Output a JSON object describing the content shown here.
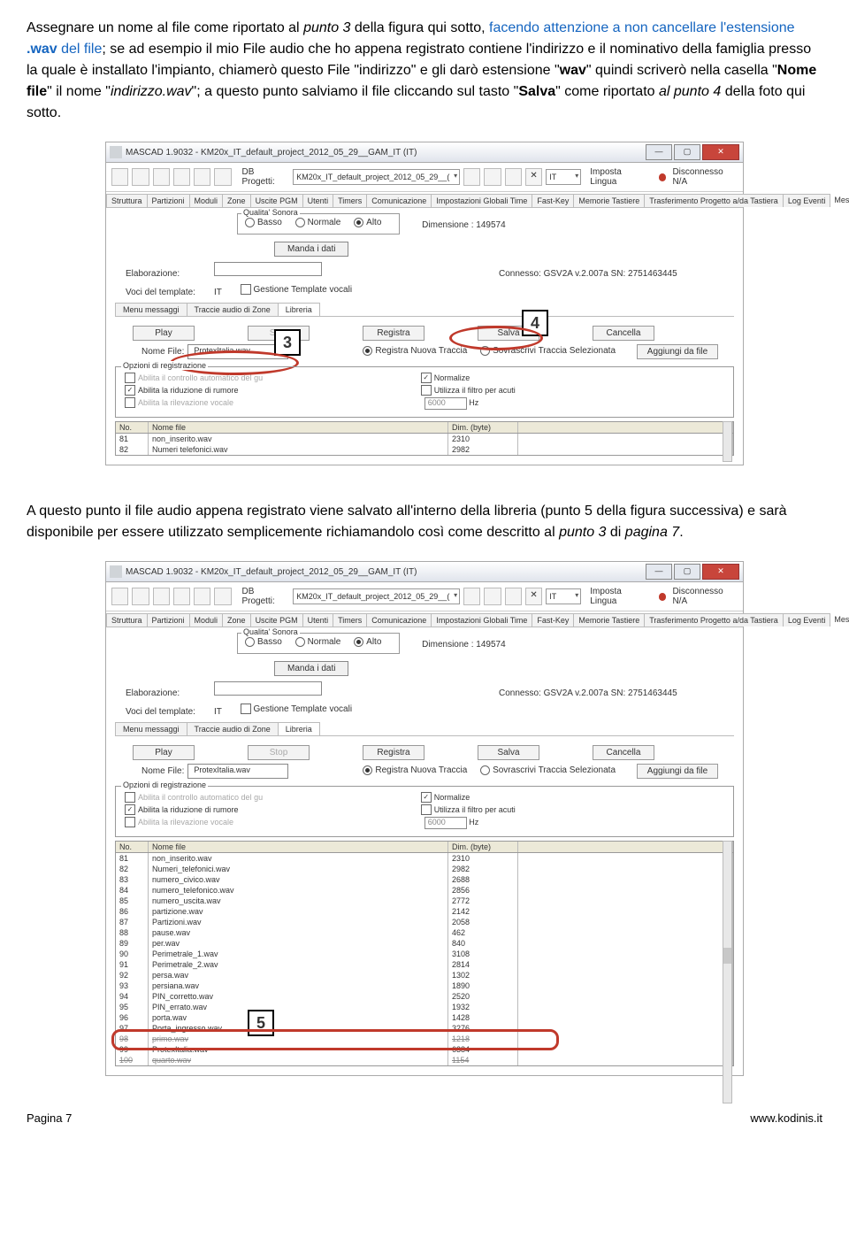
{
  "para1": {
    "t1": "Assegnare un nome al file come riportato al ",
    "p3": "punto 3",
    "t2": " della figura qui sotto, ",
    "blue1": "facendo attenzione a non cancellare l'estensione ",
    "ext": ".wav",
    "blue2": " del file",
    "t3": "; se ad esempio il mio File audio che ho appena registrato contiene l'indirizzo e il nominativo della famiglia presso la quale è installato l'impianto, chiamerò questo File \"indirizzo\" e gli darò estensione \"",
    "wav": "wav",
    "t4": "\" quindi scriverò nella casella \"",
    "nomefile": "Nome file",
    "t5": "\" il nome \"",
    "fname": "indirizzo.wav",
    "t6": "\"; a questo punto salviamo il file cliccando sul tasto \"",
    "salva": "Salva",
    "t7": "\" come riportato ",
    "p4": "al punto 4",
    "t8": " della foto qui sotto."
  },
  "para2": {
    "t1": "A questo punto il file audio appena registrato viene salvato all'interno della libreria (punto 5 della figura successiva) e sarà disponibile per essere utilizzato semplicemente richiamandolo così come descritto al ",
    "p3": "punto 3",
    "t2": " di ",
    "pg": "pagina 7",
    "t3": "."
  },
  "app": {
    "title": "MASCAD 1.9032  -  KM20x_IT_default_project_2012_05_29__GAM_IT (IT)",
    "dbLabel": "DB Progetti:",
    "dbValue": "KM20x_IT_default_project_2012_05_29__(",
    "lang": "IT",
    "imposta": "Imposta Lingua",
    "disc": "Disconnesso  N/A",
    "tabs": [
      "Struttura",
      "Partizioni",
      "Moduli",
      "Zone",
      "Uscite PGM",
      "Utenti",
      "Timers",
      "Comunicazione",
      "Impostazioni Globali Time",
      "Fast-Key",
      "Memorie Tastiere",
      "Trasferimento Progetto a/da Tastiera",
      "Log Eventi"
    ],
    "msgvoce": "Messaggio voce n.s",
    "quality": {
      "legend": "Qualita' Sonora",
      "basso": "Basso",
      "normale": "Normale",
      "alto": "Alto",
      "dim": "Dimensione : 149574"
    },
    "manda": "Manda i dati",
    "elab": "Elaborazione:",
    "connesso": "Connesso: GSV2A v.2.007a SN: 2751463445",
    "voci": "Voci del template:",
    "it": "IT",
    "gestione": "Gestione Template vocali",
    "subtabs": [
      "Menu messaggi",
      "Traccie audio di Zone",
      "Libreria"
    ],
    "play": "Play",
    "stop": "Stop",
    "registra": "Registra",
    "salva": "Salva",
    "cancella": "Cancella",
    "nomefileLbl": "Nome File:",
    "nomefileVal": "ProtexItalia.wav",
    "regNuova": "Registra Nuova Traccia",
    "sovras": "Sovrascrivi Traccia Selezionata",
    "aggiungi": "Aggiungi da file",
    "optLegend": "Opzioni di registrazione",
    "opt1": "Abilita il controllo automatico del gu",
    "opt2": "Abilita la riduzione di rumore",
    "opt3": "Abilita la rilevazione vocale",
    "norm": "Normalize",
    "filtro": "Utilizza il filtro per acuti",
    "hz": "6000",
    "hzu": "Hz",
    "cols": {
      "no": "No.",
      "nome": "Nome file",
      "dim": "Dim. (byte)"
    }
  },
  "shot1_rows": [
    {
      "n": "81",
      "f": "non_inserito.wav",
      "d": "2310"
    },
    {
      "n": "82",
      "f": "Numeri  telefonici.wav",
      "d": "2982"
    }
  ],
  "shot2_rows": [
    {
      "n": "81",
      "f": "non_inserito.wav",
      "d": "2310"
    },
    {
      "n": "82",
      "f": "Numeri_telefonici.wav",
      "d": "2982"
    },
    {
      "n": "83",
      "f": "numero_civico.wav",
      "d": "2688"
    },
    {
      "n": "84",
      "f": "numero_telefonico.wav",
      "d": "2856"
    },
    {
      "n": "85",
      "f": "numero_uscita.wav",
      "d": "2772"
    },
    {
      "n": "86",
      "f": "partizione.wav",
      "d": "2142"
    },
    {
      "n": "87",
      "f": "Partizioni.wav",
      "d": "2058"
    },
    {
      "n": "88",
      "f": "pause.wav",
      "d": "462"
    },
    {
      "n": "89",
      "f": "per.wav",
      "d": "840"
    },
    {
      "n": "90",
      "f": "Perimetrale_1.wav",
      "d": "3108"
    },
    {
      "n": "91",
      "f": "Perimetrale_2.wav",
      "d": "2814"
    },
    {
      "n": "92",
      "f": "persa.wav",
      "d": "1302"
    },
    {
      "n": "93",
      "f": "persiana.wav",
      "d": "1890"
    },
    {
      "n": "94",
      "f": "PIN_corretto.wav",
      "d": "2520"
    },
    {
      "n": "95",
      "f": "PIN_errato.wav",
      "d": "1932"
    },
    {
      "n": "96",
      "f": "porta.wav",
      "d": "1428"
    },
    {
      "n": "97",
      "f": "Porta_ingresso.wav",
      "d": "3276"
    },
    {
      "n": "98",
      "f": "primo.wav",
      "d": "1218"
    },
    {
      "n": "99",
      "f": "ProtexItalia.wav",
      "d": "6384"
    },
    {
      "n": "100",
      "f": "quarto.wav",
      "d": "1154"
    }
  ],
  "call3": "3",
  "call4": "4",
  "call5": "5",
  "footer": {
    "page": "Pagina 7",
    "site": "www.kodinis.it"
  }
}
